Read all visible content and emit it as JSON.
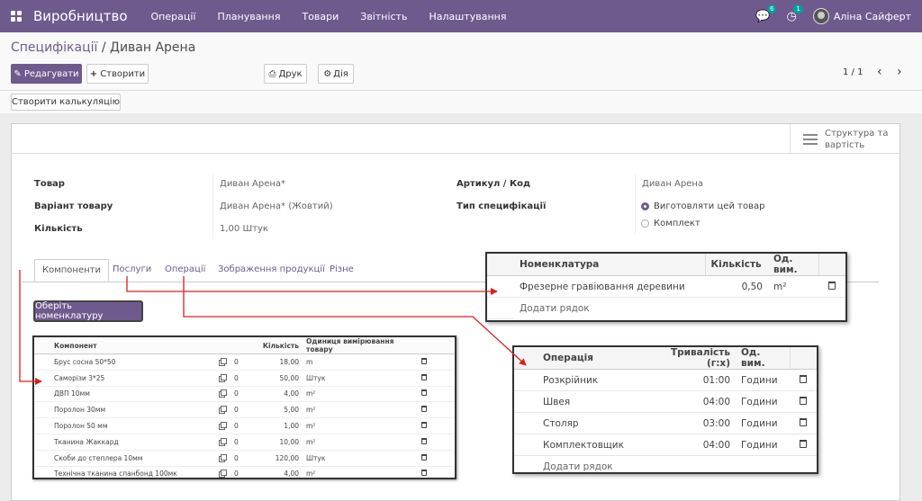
{
  "app": {
    "name": "Виробництво"
  },
  "menu": [
    "Операції",
    "Планування",
    "Товари",
    "Звітність",
    "Налаштування"
  ],
  "notifications": {
    "messages_count": "6",
    "activities_count": "1"
  },
  "user": {
    "name": "Аліна Сайферт"
  },
  "breadcrumb": {
    "parent": "Специфікації",
    "separator": " / ",
    "current": "Диван Арена"
  },
  "toolbar": {
    "edit": "Редагувати",
    "create": "Створити",
    "print": "Друк",
    "action": "Дія"
  },
  "pager": {
    "text": "1 / 1"
  },
  "secondary": {
    "create_costing": "Створити калькуляцію"
  },
  "smart_button": {
    "line1": "Структура та",
    "line2": "вартість"
  },
  "form": {
    "product_label": "Товар",
    "product_value": "Диван Арена*",
    "variant_label": "Варіант товару",
    "variant_value": "Диван Арена* (Жовтий)",
    "qty_label": "Кількість",
    "qty_value": "1,00 Штук",
    "ref_label": "Артикул / Код",
    "ref_value": "Диван Арена",
    "type_label": "Тип специфікації",
    "type_options": [
      "Виготовляти цей товар",
      "Комплект"
    ]
  },
  "tabs": [
    "Компоненти",
    "Послуги",
    "Операції",
    "Зображення продукції",
    "Різне"
  ],
  "select_button": "Оберіть номенклатуру",
  "components": {
    "headers": [
      "Компонент",
      "Кількість",
      "Одиниця вимірювання товару"
    ],
    "rows": [
      {
        "name": "Брус сосна 50*50",
        "zero": "0",
        "qty": "18,00",
        "uom": "m"
      },
      {
        "name": "Саморізи 3*25",
        "zero": "0",
        "qty": "50,00",
        "uom": "Штук"
      },
      {
        "name": "ДВП 10мм",
        "zero": "0",
        "qty": "4,00",
        "uom": "m²"
      },
      {
        "name": "Поролон 30мм",
        "zero": "0",
        "qty": "5,00",
        "uom": "m²"
      },
      {
        "name": "Поролон 50 мм",
        "zero": "0",
        "qty": "1,00",
        "uom": "m²"
      },
      {
        "name": "Тканина Жаккард",
        "zero": "0",
        "qty": "10,00",
        "uom": "m²"
      },
      {
        "name": "Скоби до степлера 10мм",
        "zero": "0",
        "qty": "120,00",
        "uom": "Штук"
      },
      {
        "name": "Технічна тканина спанбонд 100мк",
        "zero": "0",
        "qty": "4,00",
        "uom": "m²"
      }
    ]
  },
  "services": {
    "headers": [
      "Номенклатура",
      "Кількість",
      "Од. вим."
    ],
    "rows": [
      {
        "name": "Фрезерне гравіювання деревини",
        "qty": "0,50",
        "uom": "m²"
      }
    ],
    "add_line": "Додати рядок"
  },
  "operations": {
    "headers": [
      "Операція",
      "Тривалість (г:х)",
      "Од. вим."
    ],
    "rows": [
      {
        "name": "Розкрійник",
        "dur": "01:00",
        "uom": "Години"
      },
      {
        "name": "Швея",
        "dur": "04:00",
        "uom": "Години"
      },
      {
        "name": "Столяр",
        "dur": "03:00",
        "uom": "Години"
      },
      {
        "name": "Комплектовщик",
        "dur": "04:00",
        "uom": "Години"
      }
    ],
    "add_line": "Додати рядок"
  },
  "colors": {
    "brand": "#6f5a8e",
    "annotation": "#d9211e"
  }
}
